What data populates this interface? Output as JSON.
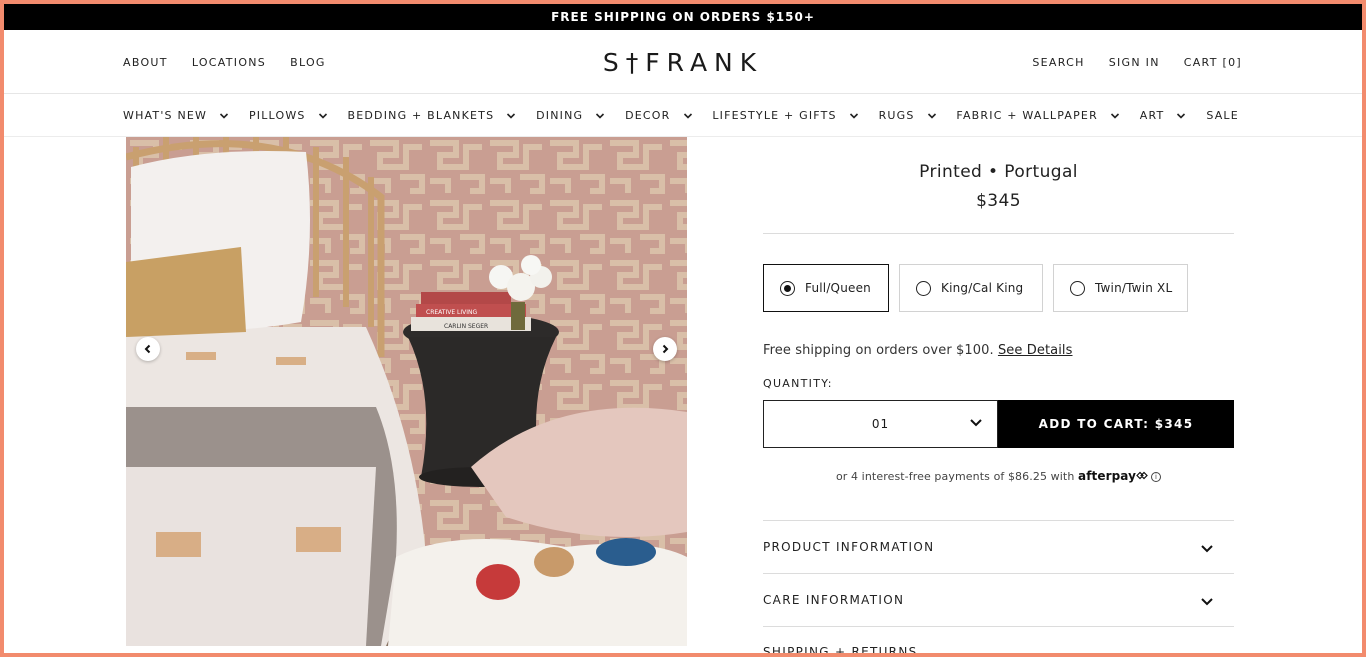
{
  "announcement": "FREE SHIPPING ON ORDERS $150+",
  "header": {
    "left_links": [
      "ABOUT",
      "LOCATIONS",
      "BLOG"
    ],
    "logo": "S†FRANK",
    "right_links": [
      "SEARCH",
      "SIGN IN",
      "CART [0]"
    ]
  },
  "nav": {
    "items": [
      {
        "label": "WHAT'S NEW",
        "has_dropdown": true
      },
      {
        "label": "PILLOWS",
        "has_dropdown": true
      },
      {
        "label": "BEDDING + BLANKETS",
        "has_dropdown": true
      },
      {
        "label": "DINING",
        "has_dropdown": true
      },
      {
        "label": "DECOR",
        "has_dropdown": true
      },
      {
        "label": "LIFESTYLE + GIFTS",
        "has_dropdown": true
      },
      {
        "label": "RUGS",
        "has_dropdown": true
      },
      {
        "label": "FABRIC + WALLPAPER",
        "has_dropdown": true
      },
      {
        "label": "ART",
        "has_dropdown": true
      },
      {
        "label": "SALE",
        "has_dropdown": false
      }
    ]
  },
  "gallery": {
    "prev_icon": "chevron-left-icon",
    "next_icon": "chevron-right-icon",
    "book_texts": [
      "CREATIVE LIVING",
      "CARLIN SEGER"
    ]
  },
  "product": {
    "title": "Printed • Portugal",
    "price": "$345",
    "sizes": [
      {
        "label": "Full/Queen",
        "selected": true
      },
      {
        "label": "King/Cal King",
        "selected": false
      },
      {
        "label": "Twin/Twin XL",
        "selected": false
      }
    ],
    "shipping_text": "Free shipping on orders over $100.",
    "shipping_link": "See Details",
    "quantity_label": "QUANTITY:",
    "quantity_value": "01",
    "add_to_cart": "ADD TO CART: $345",
    "afterpay_text": "or 4 interest-free payments of $86.25 with",
    "afterpay_brand": "afterpay",
    "afterpay_info": "i"
  },
  "accordions": [
    {
      "label": "PRODUCT INFORMATION"
    },
    {
      "label": "CARE INFORMATION"
    },
    {
      "label": "SHIPPING + RETURNS"
    }
  ],
  "colors": {
    "frame": "#f28b6d",
    "announcement_bg": "#000000",
    "button_bg": "#000000",
    "wall": "#c8a49a"
  }
}
